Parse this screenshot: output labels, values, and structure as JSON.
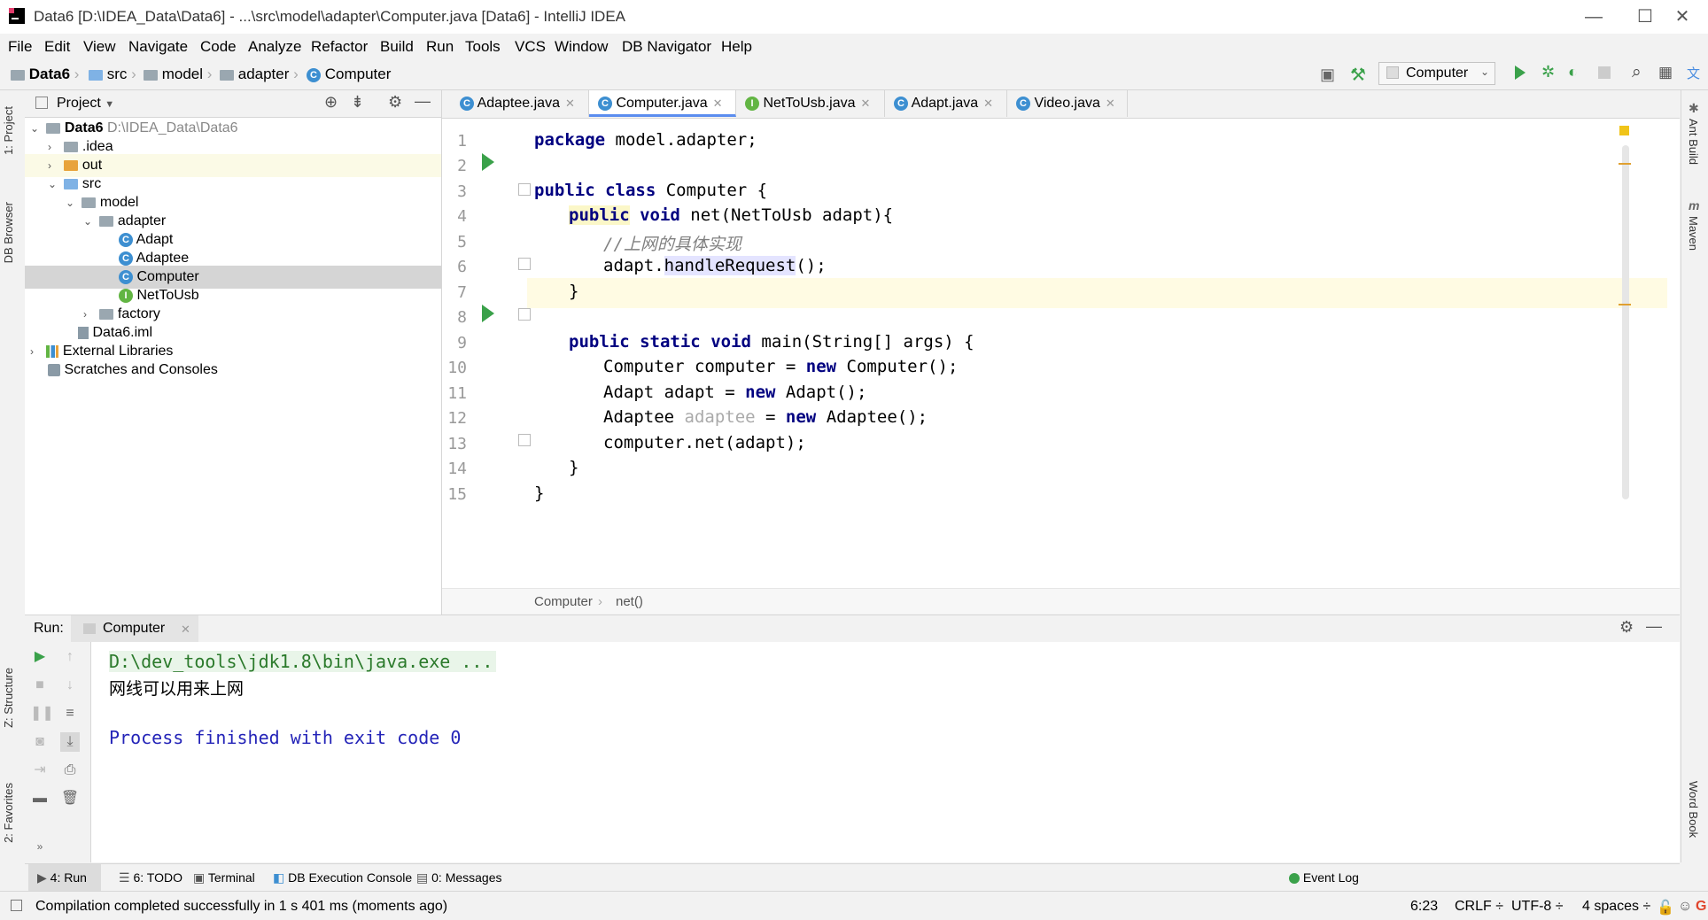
{
  "window": {
    "title": "Data6 [D:\\IDEA_Data\\Data6] - ...\\src\\model\\adapter\\Computer.java [Data6] - IntelliJ IDEA",
    "minimize": "—",
    "maximize": "☐",
    "close": "✕"
  },
  "menu": [
    "File",
    "Edit",
    "View",
    "Navigate",
    "Code",
    "Analyze",
    "Refactor",
    "Build",
    "Run",
    "Tools",
    "VCS",
    "Window",
    "DB Navigator",
    "Help"
  ],
  "breadcrumb": [
    "Data6",
    "src",
    "model",
    "adapter",
    "Computer"
  ],
  "run_config": "Computer",
  "left_tabs": {
    "project": "1: Project",
    "db_browser": "DB Browser",
    "structure": "Z: Structure",
    "favorites": "2: Favorites"
  },
  "right_tabs": {
    "ant": "Ant Build",
    "maven": "Maven",
    "word": "Word Book"
  },
  "project_panel": {
    "title": "Project",
    "tree": [
      {
        "label": "Data6",
        "path": "D:\\IDEA_Data\\Data6"
      },
      {
        "label": ".idea"
      },
      {
        "label": "out"
      },
      {
        "label": "src"
      },
      {
        "label": "model"
      },
      {
        "label": "adapter"
      },
      {
        "label": "Adapt"
      },
      {
        "label": "Adaptee"
      },
      {
        "label": "Computer"
      },
      {
        "label": "NetToUsb"
      },
      {
        "label": "factory"
      },
      {
        "label": "Data6.iml"
      },
      {
        "label": "External Libraries"
      },
      {
        "label": "Scratches and Consoles"
      }
    ]
  },
  "tabs": [
    "Adaptee.java",
    "Computer.java",
    "NetToUsb.java",
    "Adapt.java",
    "Video.java"
  ],
  "code": {
    "line_numbers": [
      "1",
      "2",
      "3",
      "4",
      "5",
      "6",
      "7",
      "8",
      "9",
      "10",
      "11",
      "12",
      "13",
      "14",
      "15"
    ],
    "l1_kw": "package",
    "l1_rest": " model.adapter;",
    "l3_kw1": "public",
    "l3_kw2": "class",
    "l3_rest": " Computer {",
    "l4_kw1": "public",
    "l4_kw2": "void",
    "l4_rest": " net(NetToUsb adapt){",
    "l5": "//上网的具体实现",
    "l6_a": "adapt.",
    "l6_m": "handleRequest",
    "l6_b": "();",
    "l7": "}",
    "l9_kw1": "public",
    "l9_kw2": "static",
    "l9_kw3": "void",
    "l9_rest": " main(String[] args) {",
    "l10_a": "Computer computer = ",
    "l10_kw": "new",
    "l10_b": " Computer();",
    "l11_a": "Adapt adapt = ",
    "l11_kw": "new",
    "l11_b": " Adapt();",
    "l12_a": "Adaptee ",
    "l12_unused": "adaptee",
    "l12_b": " = ",
    "l12_kw": "new",
    "l12_c": " Adaptee();",
    "l13": "computer.net(adapt);",
    "l14": "}",
    "l15": "}"
  },
  "editor_breadcrumb": [
    "Computer",
    "net()"
  ],
  "run_panel": {
    "label": "Run:",
    "tab": "Computer",
    "cmd": "D:\\dev_tools\\jdk1.8\\bin\\java.exe ...",
    "output": "网线可以用来上网",
    "finished": "Process finished with exit code 0"
  },
  "bottom_tabs": [
    "4: Run",
    "6: TODO",
    "Terminal",
    "DB Execution Console",
    "0: Messages"
  ],
  "event_log": "Event Log",
  "status": {
    "message": "Compilation completed successfully in 1 s 401 ms (moments ago)",
    "position": "6:23",
    "line_sep": "CRLF ÷",
    "encoding": "UTF-8 ÷",
    "indent": "4 spaces ÷"
  },
  "colors": {
    "keyword": "#000080",
    "comment": "#808080",
    "run_green": "#3aa14a",
    "console_cmd": "#2b7a2b",
    "console_blue": "#2424b8"
  }
}
